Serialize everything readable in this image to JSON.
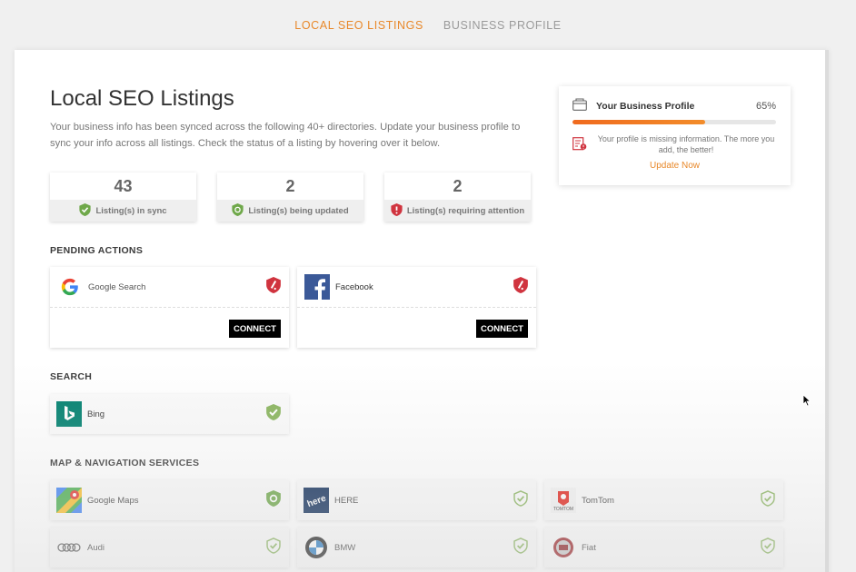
{
  "nav": {
    "tabs": [
      {
        "label": "LOCAL SEO LISTINGS",
        "active": true
      },
      {
        "label": "BUSINESS PROFILE",
        "active": false
      }
    ],
    "accent": "#e8882a"
  },
  "header": {
    "title": "Local SEO Listings",
    "description": "Your business info has been synced across the following 40+ directories. Update your business profile to sync your info across all listings. Check the status of a listing by hovering over it below."
  },
  "stats": [
    {
      "value": "43",
      "label": "Listing(s) in sync",
      "icon": "shield-check-icon",
      "color": "#6fa84a"
    },
    {
      "value": "2",
      "label": "Listing(s) being updated",
      "icon": "shield-sync-icon",
      "color": "#6fa84a"
    },
    {
      "value": "2",
      "label": "Listing(s) requiring attention",
      "icon": "shield-alert-icon",
      "color": "#d0343f"
    }
  ],
  "sections": {
    "pending": "PENDING ACTIONS",
    "search": "SEARCH",
    "maps": "MAP & NAVIGATION SERVICES"
  },
  "pending_actions": [
    {
      "name": "Google Search",
      "icon": "google-icon",
      "status": "attention",
      "button": "CONNECT"
    },
    {
      "name": "Facebook",
      "icon": "facebook-icon",
      "status": "attention",
      "button": "CONNECT"
    }
  ],
  "search_listings": [
    {
      "name": "Bing",
      "icon": "bing-icon",
      "status": "in-sync"
    }
  ],
  "map_listings": [
    {
      "name": "Google Maps",
      "icon": "google-maps-icon",
      "status": "updating"
    },
    {
      "name": "HERE",
      "icon": "here-icon",
      "status": "in-sync"
    },
    {
      "name": "TomTom",
      "icon": "tomtom-icon",
      "status": "in-sync"
    },
    {
      "name": "Audi",
      "icon": "audi-icon",
      "status": "in-sync"
    },
    {
      "name": "BMW",
      "icon": "bmw-icon",
      "status": "in-sync"
    },
    {
      "name": "Fiat",
      "icon": "fiat-icon",
      "status": "in-sync"
    }
  ],
  "profile": {
    "title": "Your Business Profile",
    "percent_label": "65%",
    "progress": 0.65,
    "message": "Your profile is missing information. The more you add, the better!",
    "cta": "Update Now"
  }
}
